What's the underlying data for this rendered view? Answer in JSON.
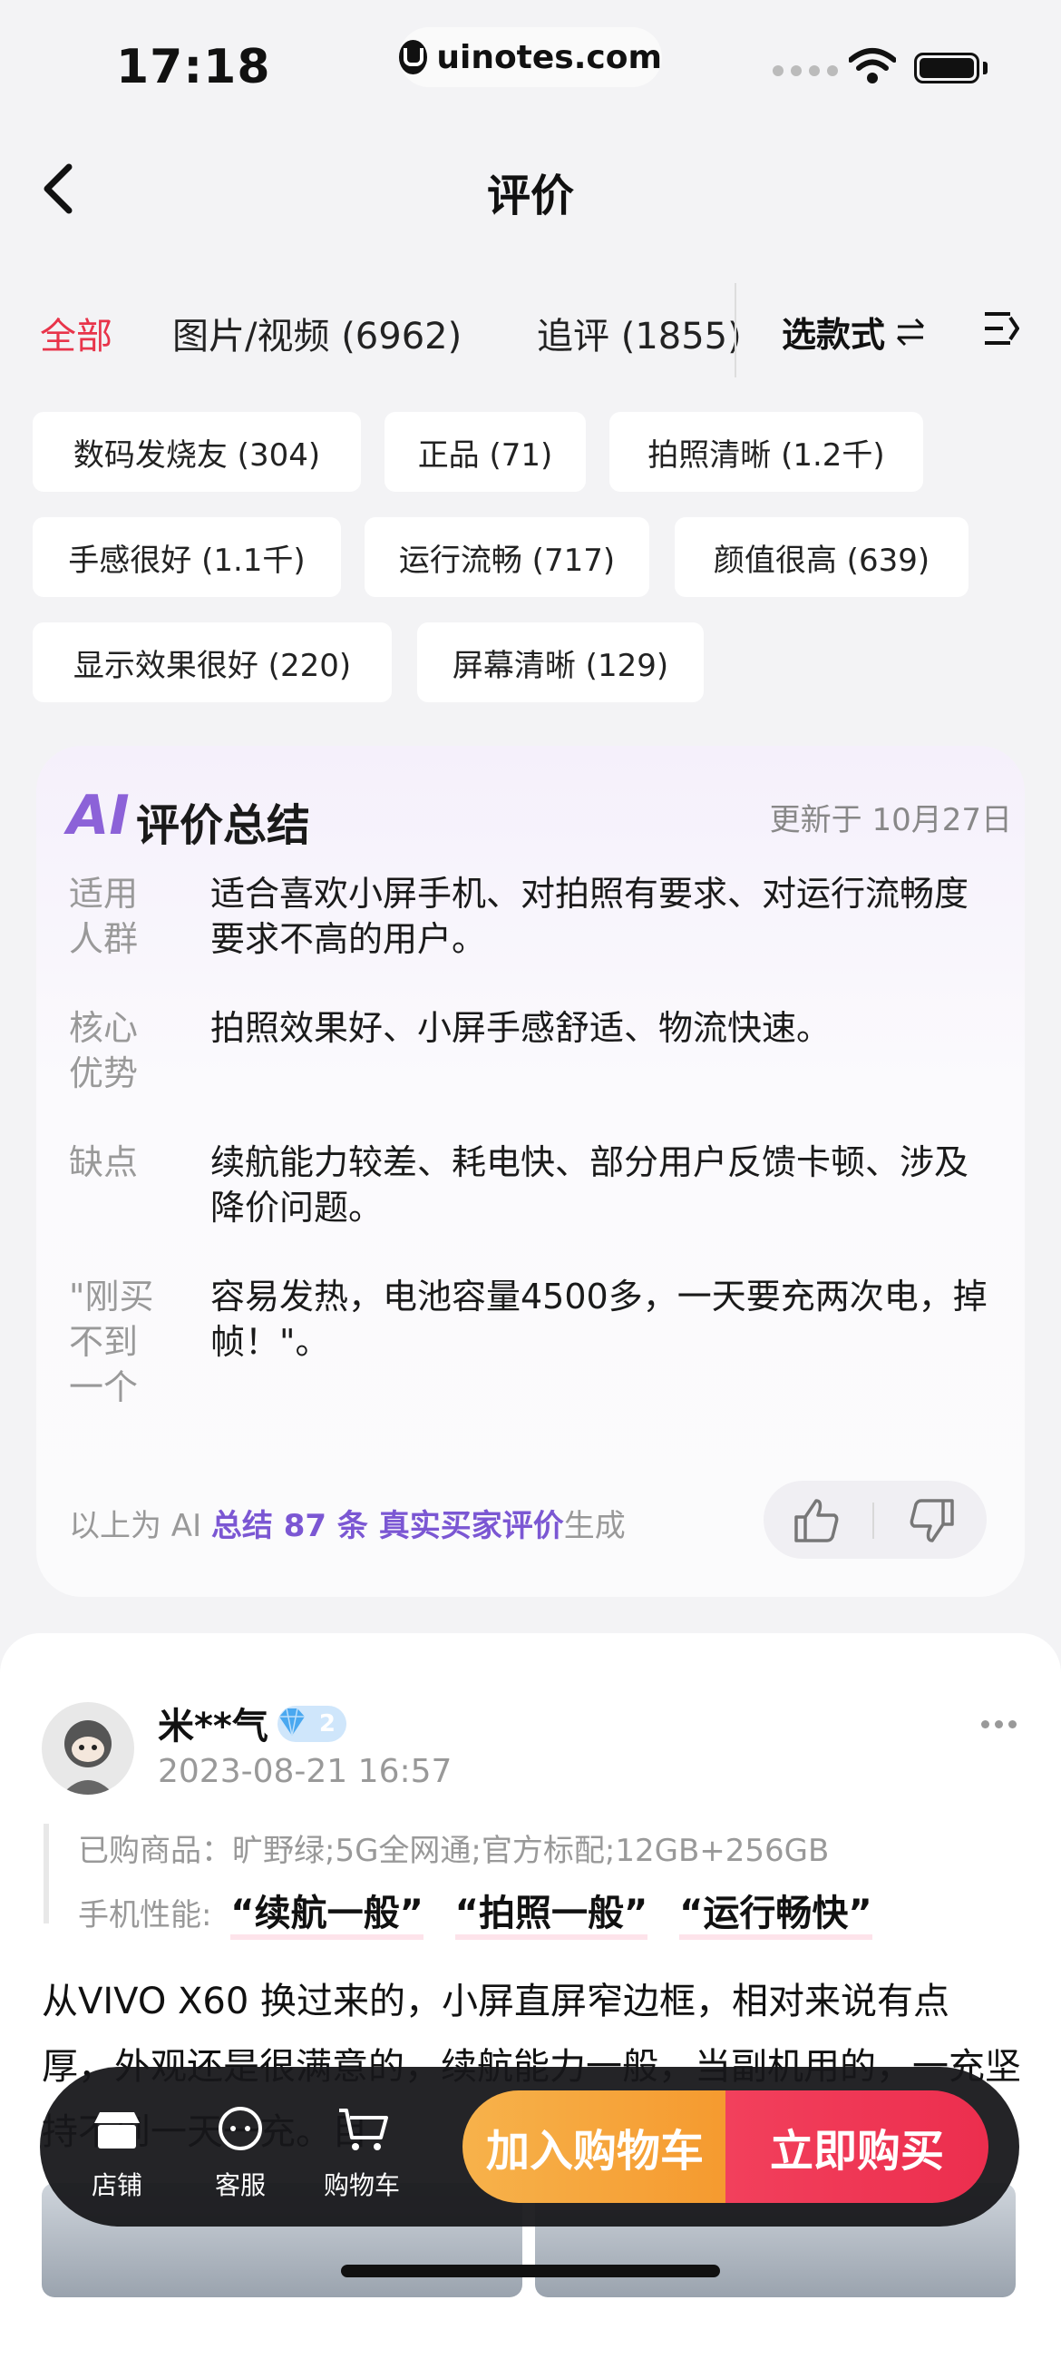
{
  "status": {
    "time": "17:18",
    "url": "uinotes.com"
  },
  "nav": {
    "title": "评价"
  },
  "tabs": [
    {
      "label": "全部",
      "active": true
    },
    {
      "label": "图片/视频 (6962)",
      "active": false
    },
    {
      "label": "追评 (1855)",
      "active": false
    }
  ],
  "style_select": "选款式",
  "chips": [
    "数码发烧友 (304)",
    "正品 (71)",
    "拍照清晰 (1.2千)",
    "手感很好 (1.1千)",
    "运行流畅 (717)",
    "颜值很高 (639)",
    "显示效果很好 (220)",
    "屏幕清晰 (129)"
  ],
  "ai_summary": {
    "logo": "AI",
    "title": "评价总结",
    "updated": "更新于 10月27日",
    "rows": [
      {
        "label": "适用人群",
        "text": "适合喜欢小屏手机、对拍照有要求、对运行流畅度要求不高的用户。"
      },
      {
        "label": "核心优势",
        "text": "拍照效果好、小屏手感舒适、物流快速。"
      },
      {
        "label": "缺点",
        "text": "续航能力较差、耗电快、部分用户反馈卡顿、涉及降价问题。"
      },
      {
        "label": "\"刚买不到一个",
        "text": "容易发热，电池容量4500多，一天要充两次电，掉帧！\"。"
      }
    ],
    "footer_prefix": "以上为 AI ",
    "footer_bold": "总结 87 条 真实买家评价",
    "footer_suffix": "生成"
  },
  "review": {
    "user": "米**气",
    "vip_level": "2",
    "date": "2023-08-21 16:57",
    "purchased_label": "已购商品：",
    "purchased_value": "旷野绿;5G全网通;官方标配;12GB+256GB",
    "performance_label": "手机性能:",
    "performance_tags": [
      "“续航一般”",
      "“拍照一般”",
      "“运行畅快”"
    ],
    "body": "从VIVO X60 换过来的，小屏直屏窄边框，相对来说有点厚，外观还是很满意的，续航能力一般，当副机用的，一充坚持不到一天一充。目"
  },
  "bottom_bar": {
    "store": "店铺",
    "service": "客服",
    "cart": "购物车",
    "add_to_cart": "加入购物车",
    "buy_now": "立即购买"
  },
  "colors": {
    "accent": "#e8344a",
    "ai_purple": "#7b57d3",
    "cart_orange": "#f5a23a",
    "buy_red": "#ee3552"
  }
}
